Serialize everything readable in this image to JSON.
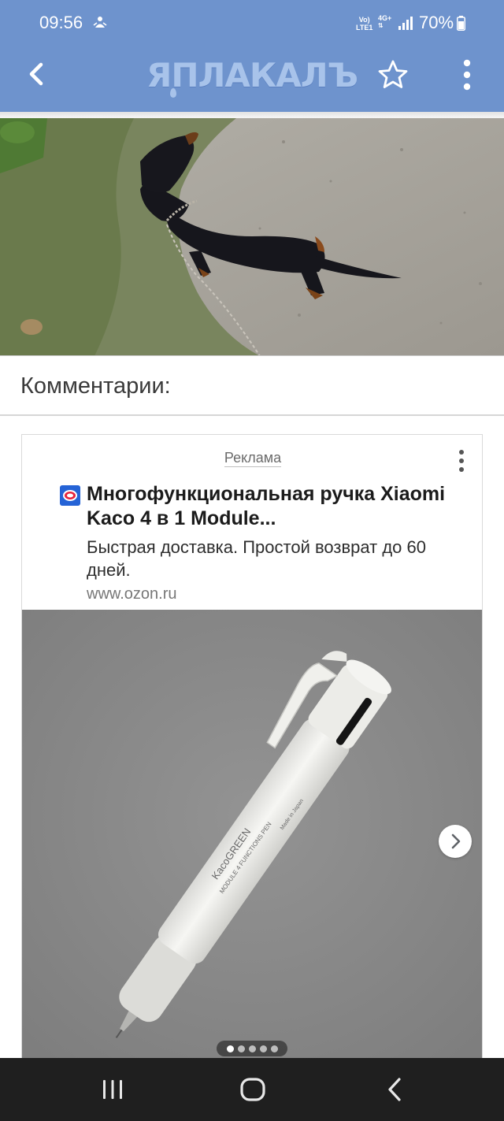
{
  "status_bar": {
    "time": "09:56",
    "volte_top": "Vo)",
    "volte_bottom": "LTE1",
    "network": "4G+",
    "battery": "70%"
  },
  "app_bar": {
    "logo": "ЯПЛАКАЛЪ",
    "back_icon": "back-arrow-icon",
    "favorite_icon": "star-outline-icon",
    "menu_icon": "more-vertical-icon"
  },
  "post": {
    "image_subject": "dachshund-photo"
  },
  "comments": {
    "title": "Комментарии:"
  },
  "ad": {
    "label": "Реклама",
    "title": "Многофункциональная ручка Xiaomi Kaco 4 в 1 Module...",
    "description": "Быстрая доставка. Простой возврат до 60 дней.",
    "url": "www.ozon.ru",
    "pen_brand": "KacoGREEN",
    "pen_model": "MODULE 4 FUNCTIONS PEN",
    "pen_made_in": "Made in Japan",
    "carousel_total": 5,
    "carousel_active": 1
  },
  "colors": {
    "app_bar": "#6e93cd",
    "nav_bar": "#1f1f1f",
    "ad_image_bg": "#8a8a8a"
  }
}
